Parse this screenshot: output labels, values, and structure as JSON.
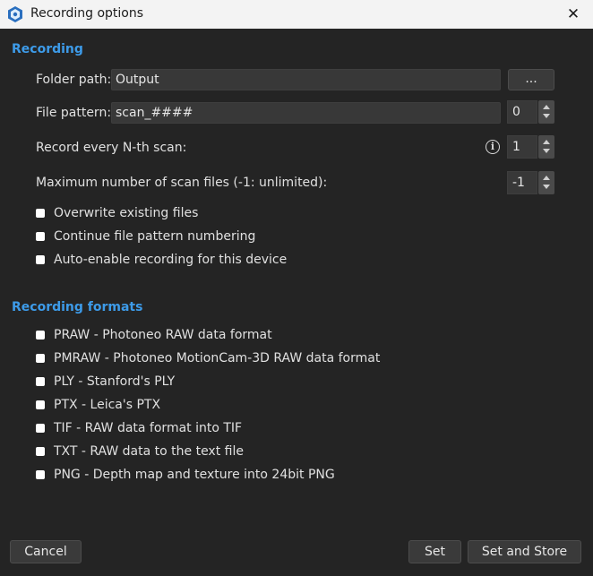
{
  "window": {
    "title": "Recording options",
    "close_symbol": "✕"
  },
  "recording": {
    "heading": "Recording",
    "folder_path_label": "Folder path:",
    "folder_path_value": "Output",
    "browse_label": "...",
    "file_pattern_label": "File pattern:",
    "file_pattern_value": "scan_####",
    "file_pattern_number": "0",
    "every_nth_label": "Record every N-th scan:",
    "every_nth_value": "1",
    "max_files_label": "Maximum number of scan files (-1: unlimited):",
    "max_files_value": "-1",
    "info_symbol": "i",
    "checkboxes": [
      {
        "label": "Overwrite existing files",
        "checked": false
      },
      {
        "label": "Continue file pattern numbering",
        "checked": false
      },
      {
        "label": "Auto-enable recording for this device",
        "checked": false
      }
    ]
  },
  "formats": {
    "heading": "Recording formats",
    "items": [
      {
        "label": "PRAW - Photoneo RAW data format",
        "checked": false
      },
      {
        "label": "PMRAW - Photoneo MotionCam-3D RAW data format",
        "checked": false
      },
      {
        "label": "PLY - Stanford's PLY",
        "checked": false
      },
      {
        "label": "PTX - Leica's PTX",
        "checked": false
      },
      {
        "label": "TIF - RAW data format into TIF",
        "checked": false
      },
      {
        "label": "TXT - RAW data to the text file",
        "checked": false
      },
      {
        "label": "PNG - Depth map and texture into 24bit PNG",
        "checked": false
      }
    ]
  },
  "buttons": {
    "cancel": "Cancel",
    "set": "Set",
    "set_and_store": "Set and Store"
  },
  "colors": {
    "accent": "#3d9be9",
    "background": "#242424",
    "titlebar": "#f3f3f3"
  }
}
